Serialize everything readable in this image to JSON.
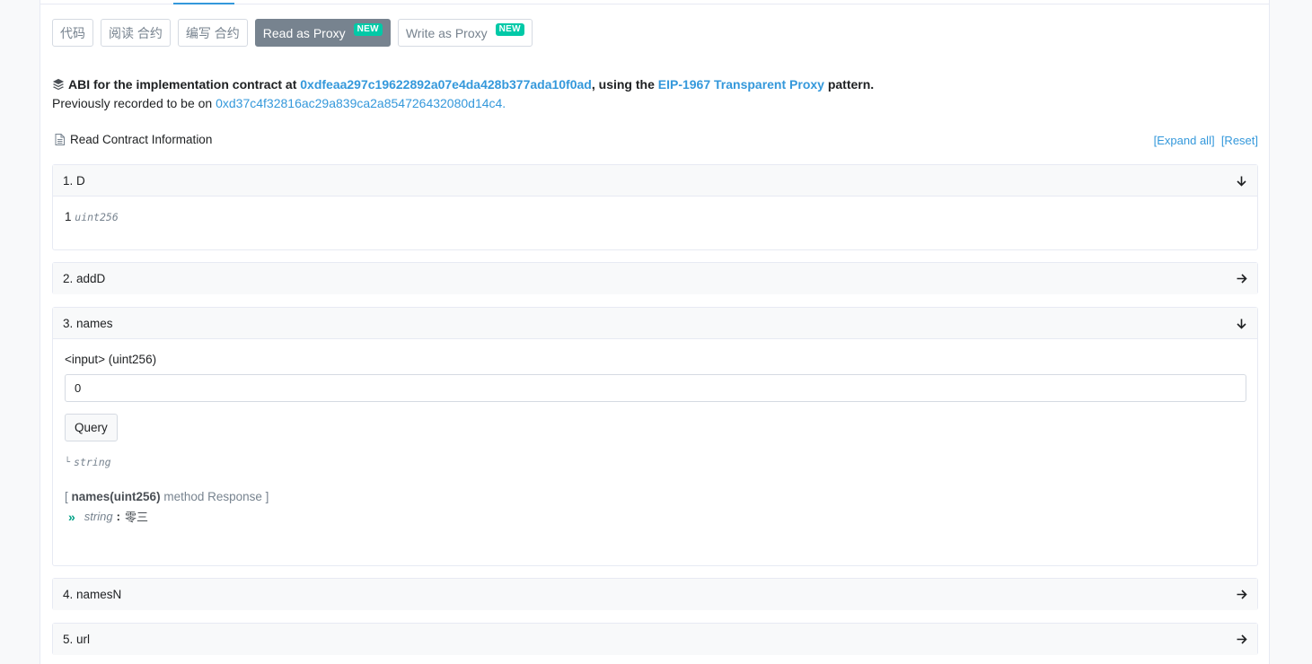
{
  "tabs": [
    {
      "label": "代码",
      "active": false
    },
    {
      "label": "阅读 合约",
      "active": false
    },
    {
      "label": "编写 合约",
      "active": false
    },
    {
      "label": "Read as Proxy",
      "badge": "NEW",
      "active": true
    },
    {
      "label": "Write as Proxy",
      "badge": "NEW",
      "active": false
    }
  ],
  "proxy": {
    "prefix": "ABI for the implementation contract at",
    "impl_address": "0xdfeaa297c19622892a07e4da428b377ada10f0ad",
    "middle": ", using the",
    "pattern_link": "EIP-1967 Transparent Proxy",
    "suffix": "pattern.",
    "prev_text": "Previously recorded to be on",
    "prev_address": "0xd37c4f32816ac29a839ca2a854726432080d14c4."
  },
  "read_info": {
    "title": "Read Contract Information",
    "expand_all": "[Expand all]",
    "reset": "[Reset]"
  },
  "functions": [
    {
      "label": "1. D",
      "open": true,
      "value": "1",
      "type": "uint256"
    },
    {
      "label": "2. addD",
      "open": false
    },
    {
      "label": "3. names",
      "open": true,
      "input_label": "<input> (uint256)",
      "input_value": "0",
      "query_label": "Query",
      "return_type": "string",
      "response_open": "[",
      "response_method": "names(uint256)",
      "response_text": "method Response ]",
      "response_type": "string",
      "response_colon": ":",
      "response_value": "零三"
    },
    {
      "label": "4. namesN",
      "open": false
    },
    {
      "label": "5. url",
      "open": false
    }
  ],
  "colors": {
    "accent": "#3498db",
    "badge": "#00c9a7",
    "active_tab": "#77838f",
    "response_arrow": "#00a186"
  }
}
